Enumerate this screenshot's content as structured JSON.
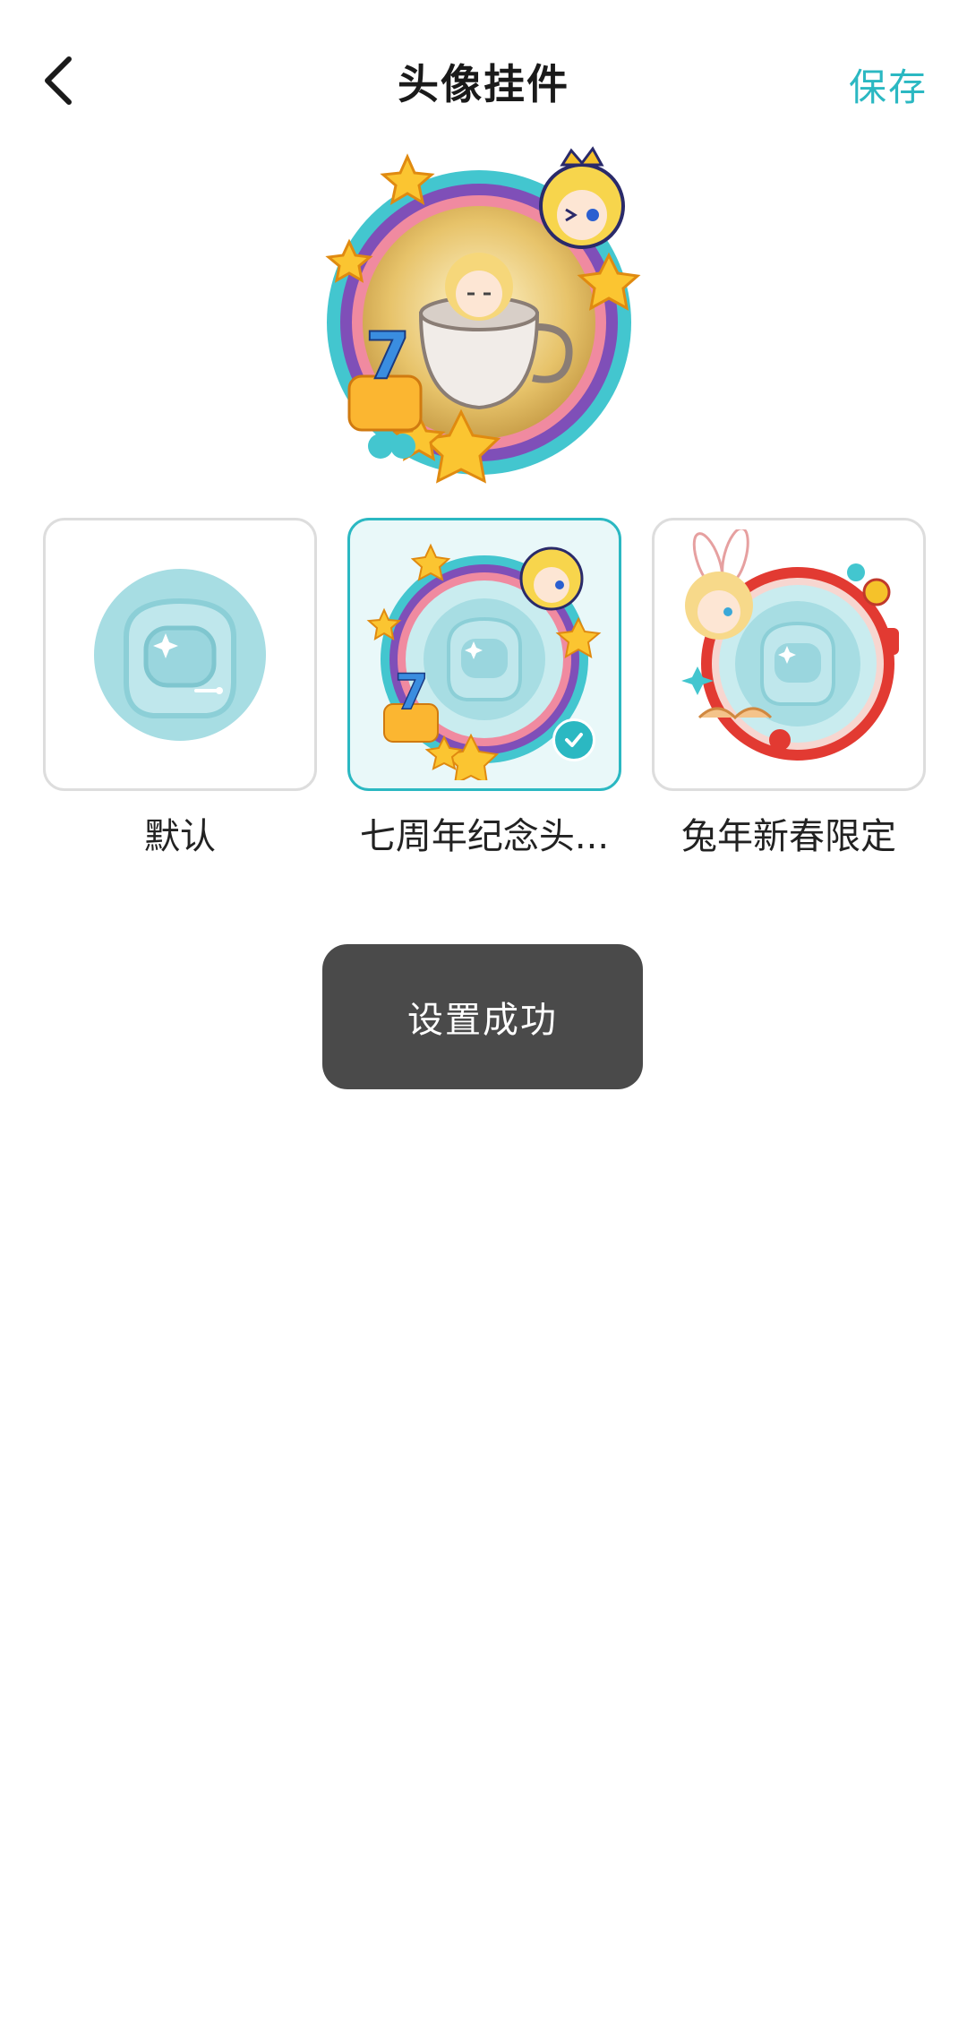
{
  "header": {
    "back_icon": "chevron-left-icon",
    "title": "头像挂件",
    "save_label": "保存"
  },
  "preview": {
    "description_icon": "avatar-pendant-preview"
  },
  "options": [
    {
      "label": "默认",
      "selected": false,
      "icon": "astronaut-helmet-icon"
    },
    {
      "label": "七周年纪念头...",
      "selected": true,
      "icon": "seventh-anniversary-frame"
    },
    {
      "label": "兔年新春限定",
      "selected": false,
      "icon": "rabbit-new-year-frame"
    }
  ],
  "toast": {
    "message": "设置成功"
  },
  "colors": {
    "accent": "#2bb8c2",
    "toast_bg": "#4a4a4a",
    "selected_bg": "#e9f8f9"
  }
}
